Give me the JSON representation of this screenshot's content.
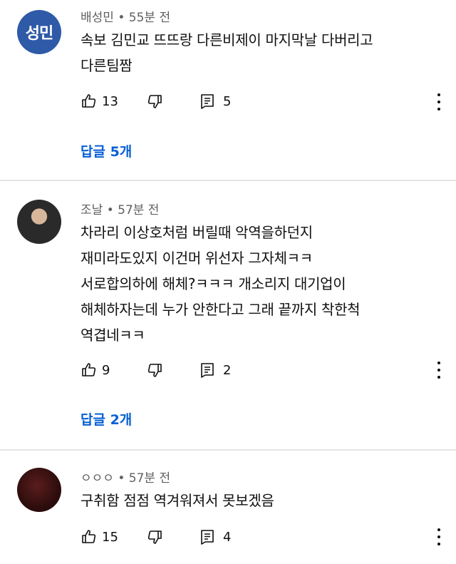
{
  "comments": [
    {
      "author": "배성민",
      "avatar_text": "성민",
      "time": "55분 전",
      "text": "속보 김민교 뜨뜨랑 다른비제이 마지막날 다버리고\n다른팀짬",
      "likes": "13",
      "reply_count": "5",
      "replies_label": "답글 5개"
    },
    {
      "author": "조날",
      "time": "57분 전",
      "text": "차라리 이상호처럼 버릴때 악역을하던지\n재미라도있지 이건머 위선자 그자체ㅋㅋ\n서로합의하에 해체?ㅋㅋㅋ 개소리지 대기업이\n해체하자는데 누가 안한다고 그래 끝까지 착한척\n역겹네ㅋㅋ",
      "likes": "9",
      "reply_count": "2",
      "replies_label": "답글 2개"
    },
    {
      "author": "ㅇㅇㅇ",
      "time": "57분 전",
      "text": "구취함 점점 역겨워져서 못보겠음",
      "likes": "15",
      "reply_count": "4"
    }
  ],
  "colors": {
    "link": "#065fd4",
    "meta": "#606060",
    "avatar": "#2f5aa8"
  },
  "icons": [
    "thumb-up-icon",
    "thumb-down-icon",
    "comment-reply-icon",
    "more-vert-icon"
  ]
}
